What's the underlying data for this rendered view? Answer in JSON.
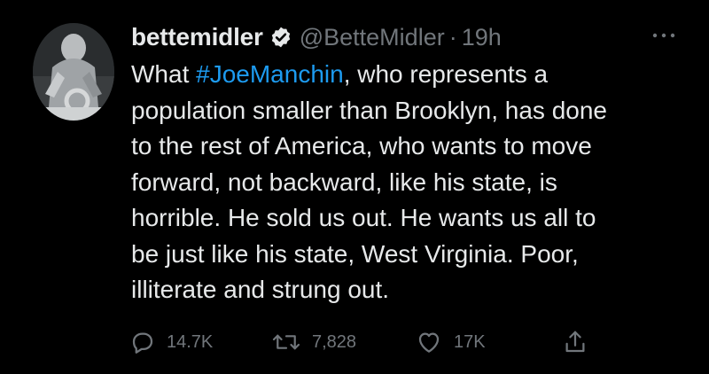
{
  "tweet": {
    "display_name": "bettemidler",
    "handle": "@BetteMidler",
    "separator": "·",
    "time": "19h",
    "verified": true,
    "avatar_icon": "statue-avatar-icon",
    "more_icon": "more-dots-icon",
    "text": {
      "line1_prefix": "What ",
      "hashtag": "#JoeManchin",
      "line1_suffix": ", who represents a",
      "line2": "population smaller than Brooklyn, has done",
      "line3": "to the rest of America, who wants to move",
      "line4": "forward, not backward, like his state, is",
      "line5": "horrible.  He sold us out.  He wants us all to",
      "line6": "be just like his state, West Virginia. Poor,",
      "line7": "illiterate and strung out."
    },
    "actions": {
      "reply": {
        "icon": "reply-icon",
        "count": "14.7K"
      },
      "retweet": {
        "icon": "retweet-icon",
        "count": "7,828"
      },
      "like": {
        "icon": "heart-icon",
        "count": "17K"
      },
      "share": {
        "icon": "share-icon"
      }
    }
  },
  "colors": {
    "background": "#000000",
    "text": "#e7e9ea",
    "secondary": "#71767b",
    "link": "#1d9bf0"
  }
}
